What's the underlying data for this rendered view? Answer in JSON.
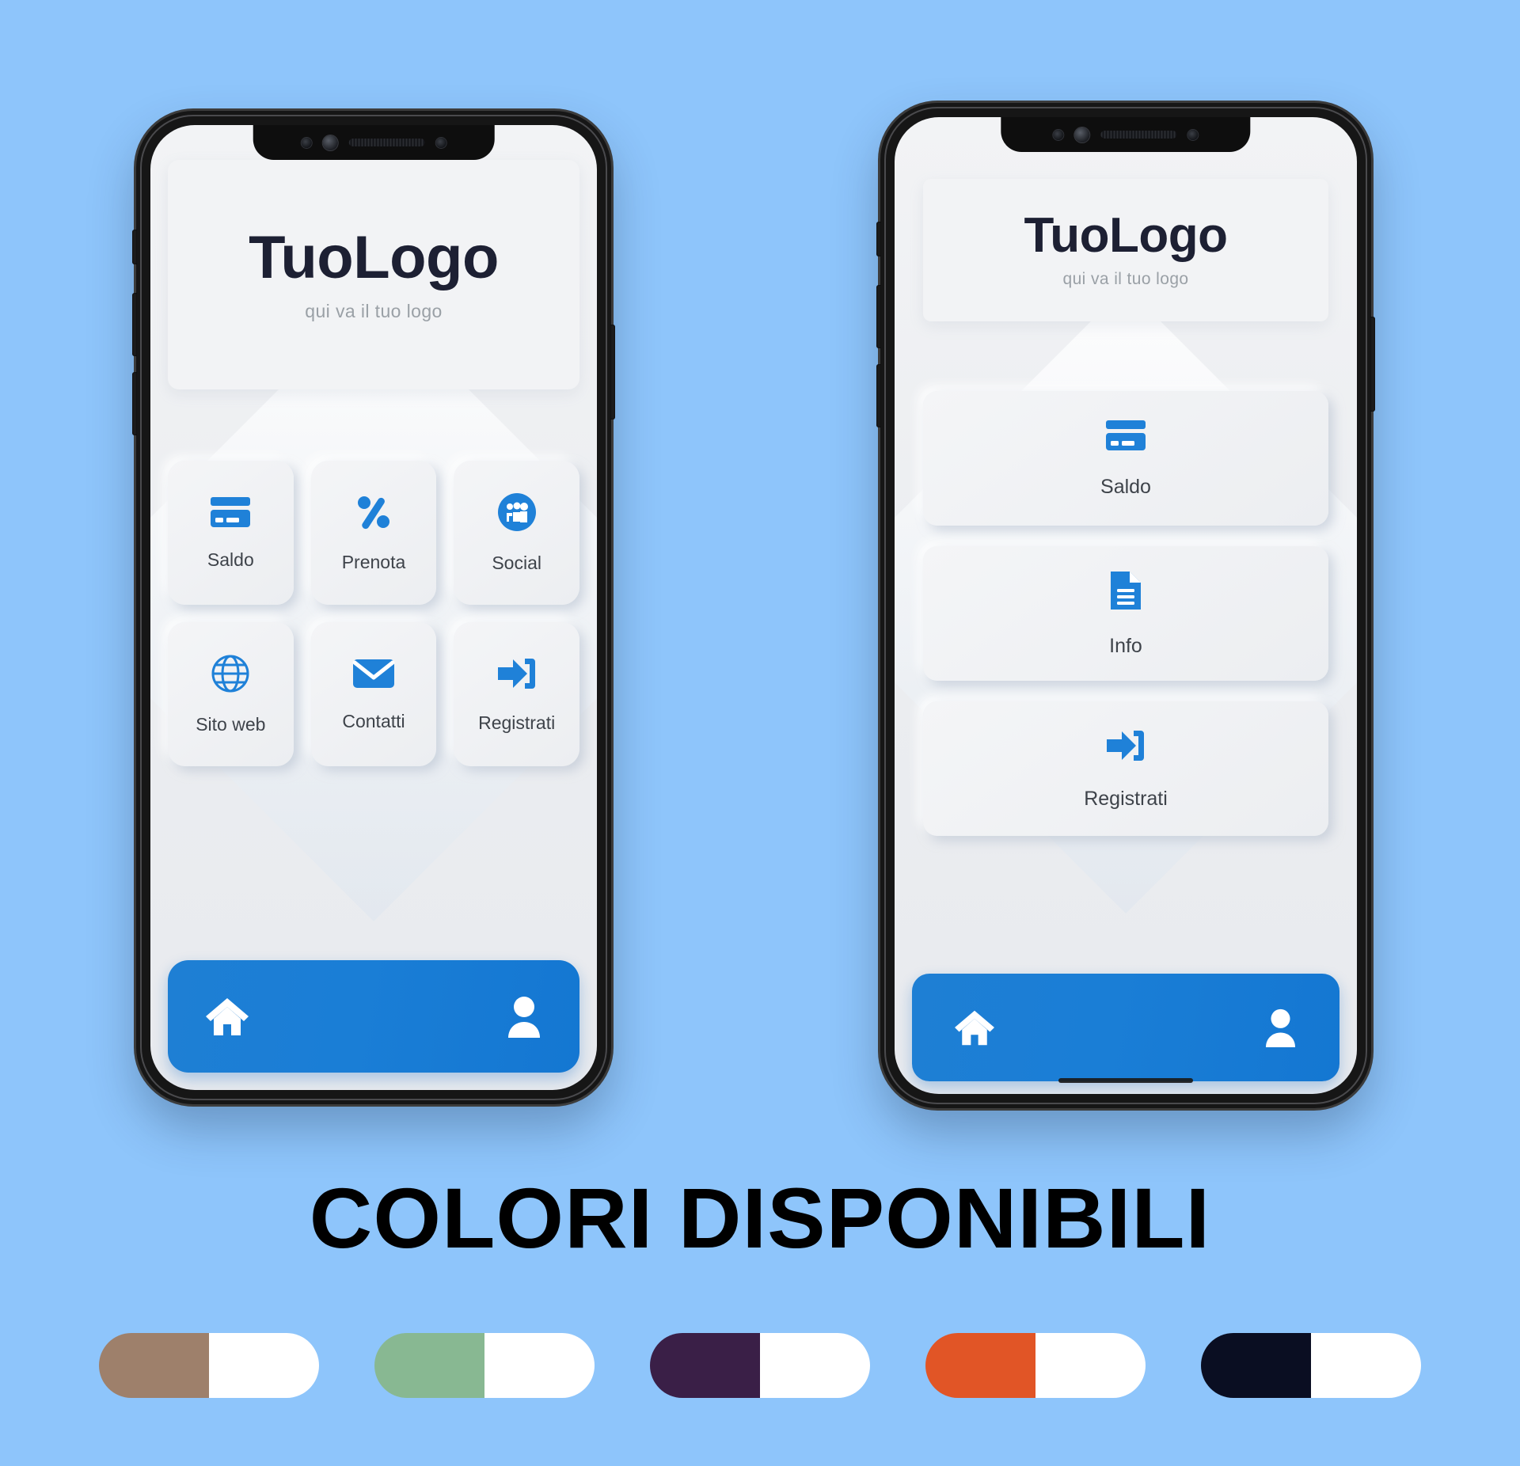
{
  "poster": {
    "background_color": "#8ec5fb",
    "colors_heading": "COLORI DISPONIBILI"
  },
  "brand": {
    "accent_blue": "#1a7ed6",
    "icon_blue": "#1f81d8",
    "logo_dark": "#1d2033",
    "tile_bg": "#f1f2f5"
  },
  "phone1": {
    "header": {
      "logo_title": "TuoLogo",
      "logo_subtitle": "qui va il tuo logo"
    },
    "tiles": [
      {
        "label": "Saldo",
        "icon": "credit-card-icon"
      },
      {
        "label": "Prenota",
        "icon": "percent-icon"
      },
      {
        "label": "Social",
        "icon": "social-group-icon"
      },
      {
        "label": "Sito web",
        "icon": "globe-icon"
      },
      {
        "label": "Contatti",
        "icon": "envelope-icon"
      },
      {
        "label": "Registrati",
        "icon": "login-arrow-icon"
      }
    ],
    "bottom_nav": [
      {
        "name": "home-icon"
      },
      {
        "name": "profile-icon"
      }
    ]
  },
  "phone2": {
    "header": {
      "logo_title": "TuoLogo",
      "logo_subtitle": "qui va il tuo logo"
    },
    "cards": [
      {
        "label": "Saldo",
        "icon": "credit-card-icon"
      },
      {
        "label": "Info",
        "icon": "document-icon"
      },
      {
        "label": "Registrati",
        "icon": "login-arrow-icon"
      }
    ],
    "bottom_nav": [
      {
        "name": "home-icon"
      },
      {
        "name": "profile-icon"
      }
    ]
  },
  "swatches": [
    {
      "name": "brown",
      "color": "#9e806b",
      "secondary": "#ffffff"
    },
    {
      "name": "green",
      "color": "#88b892",
      "secondary": "#ffffff"
    },
    {
      "name": "purple",
      "color": "#3a1f47",
      "secondary": "#ffffff"
    },
    {
      "name": "orange",
      "color": "#e15526",
      "secondary": "#ffffff"
    },
    {
      "name": "navy",
      "color": "#0a0e22",
      "secondary": "#ffffff"
    }
  ]
}
